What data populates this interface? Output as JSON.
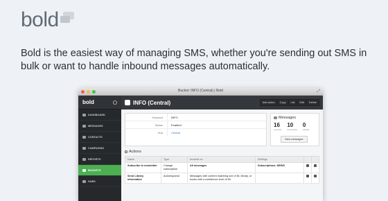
{
  "logo": {
    "text": "bold"
  },
  "tagline": "Bold is the easiest way of managing SMS, whether you're sending out SMS in bulk or want to handle inbound messages automatically.",
  "window": {
    "title": "Bucket: INFO (Central) | Bold"
  },
  "app": {
    "brand": "bold",
    "nav": [
      {
        "label": "DASHBOARD",
        "icon": "dashboard-icon"
      },
      {
        "label": "MESSAGES",
        "icon": "messages-icon"
      },
      {
        "label": "CONTACTS",
        "icon": "contacts-icon"
      },
      {
        "label": "CAMPAIGNS",
        "icon": "campaigns-icon"
      },
      {
        "label": "REPORTS",
        "icon": "reports-icon"
      },
      {
        "label": "BUCKETS",
        "icon": "buckets-icon",
        "active": true
      },
      {
        "label": "HUBS",
        "icon": "hubs-icon"
      }
    ],
    "page_title": "INFO (Central)",
    "actions": [
      "Add action",
      "Copy",
      "List",
      "Edit",
      "Delete"
    ],
    "info": [
      {
        "key": "Keyword",
        "value": "INFO"
      },
      {
        "key": "Status",
        "value": "Enabled"
      },
      {
        "key": "Hub",
        "value": "Central"
      }
    ],
    "messages": {
      "title": "Messages",
      "stats": [
        {
          "value": "16",
          "label": "received"
        },
        {
          "value": "10",
          "label": "processing"
        },
        {
          "value": "0",
          "label": "waiting"
        }
      ],
      "button": "View messages"
    },
    "actions_section": {
      "title": "Actions",
      "columns": [
        "Name",
        "Type",
        "Invoked on",
        "Settings"
      ],
      "rows": [
        {
          "name": "Subscribe to newsletter",
          "type": "Change subscription",
          "invoked": "All messages",
          "settings": "Subscriptions: NEWS"
        },
        {
          "name": "Send Library information",
          "type": "Autoresponse",
          "invoked": "Messages with content matching one of lib, library, or books with a confidence level of 80",
          "settings": ""
        }
      ]
    }
  },
  "colors": {
    "accent": "#4caf50",
    "sidebar": "#26292c",
    "topbar": "#34383c",
    "link": "#2a77c9"
  }
}
